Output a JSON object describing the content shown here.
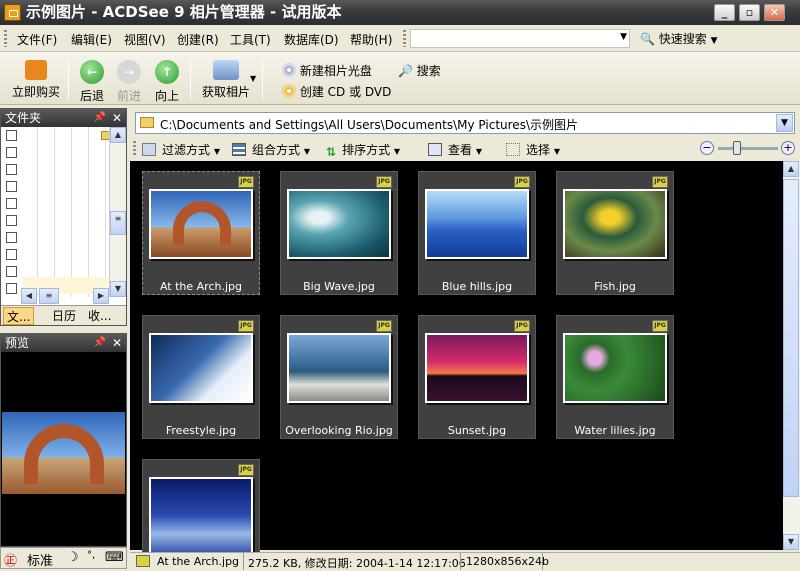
{
  "window": {
    "title": "示例图片 - ACDSee 9 相片管理器 - 试用版本"
  },
  "menus": [
    "文件(F)",
    "编辑(E)",
    "视图(V)",
    "创建(R)",
    "工具(T)",
    "数据库(D)",
    "帮助(H)"
  ],
  "quick_search": {
    "label": "快速搜索"
  },
  "toolbar": {
    "buy": "立即购买",
    "back": "后退",
    "forward": "前进",
    "up": "向上",
    "acquire": "获取相片",
    "new_cd": "新建相片光盘",
    "search": "搜索",
    "create_cd": "创建 CD 或 DVD"
  },
  "folder_pane": {
    "title": "文件夹",
    "tabs": [
      "文...",
      "日历",
      "收..."
    ]
  },
  "preview_pane": {
    "title": "预览"
  },
  "address": {
    "path": "C:\\Documents and Settings\\All Users\\Documents\\My Pictures\\示例图片"
  },
  "browse_toolbar": {
    "filter": "过滤方式",
    "group": "组合方式",
    "sort": "排序方式",
    "view": "查看",
    "select": "选择"
  },
  "files": [
    {
      "name": "At the Arch.jpg",
      "badge": "JPG"
    },
    {
      "name": "Big Wave.jpg",
      "badge": "JPG"
    },
    {
      "name": "Blue hills.jpg",
      "badge": "JPG"
    },
    {
      "name": "Fish.jpg",
      "badge": "JPG"
    },
    {
      "name": "Freestyle.jpg",
      "badge": "JPG"
    },
    {
      "name": "Overlooking Rio.jpg",
      "badge": "JPG"
    },
    {
      "name": "Sunset.jpg",
      "badge": "JPG"
    },
    {
      "name": "Water lilies.jpg",
      "badge": "JPG"
    },
    {
      "name": "",
      "badge": "JPG"
    }
  ],
  "status": {
    "file": "At the Arch.jpg",
    "info": "275.2 KB, 修改日期: 2004-1-14 12:17:06",
    "dims": "1280x856x24b"
  },
  "ime": {
    "mode": "标准"
  },
  "colors": {
    "titlebar": "#3a3b3d",
    "window": "#ece9d8",
    "grid_bg": "#000000"
  }
}
